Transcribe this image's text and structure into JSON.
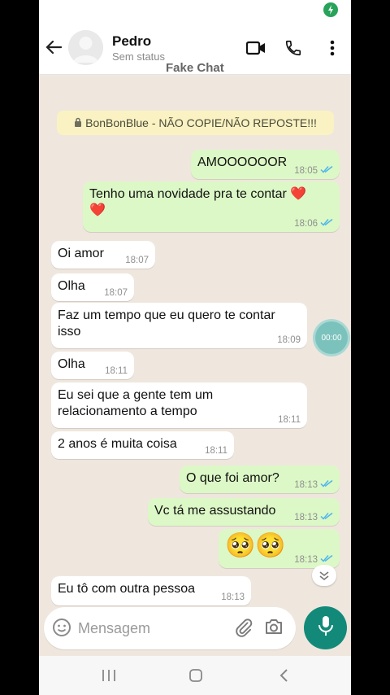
{
  "header": {
    "contact_name": "Pedro",
    "contact_status": "Sem status",
    "app_title": "Fake Chat"
  },
  "banner": {
    "text": "BonBonBlue - NÃO COPIE/NÃO REPOSTE!!!"
  },
  "messages": [
    {
      "dir": "out",
      "text": "AMOOOOOOR",
      "time": "18:05",
      "read": true
    },
    {
      "dir": "out",
      "text": "Tenho uma novidade pra te contar ❤️\n❤️",
      "time": "18:06",
      "read": true
    },
    {
      "dir": "in",
      "text": "Oi amor",
      "time": "18:07"
    },
    {
      "dir": "in",
      "text": "Olha",
      "time": "18:07"
    },
    {
      "dir": "in",
      "text": "Faz um tempo que eu quero te contar\nisso",
      "time": "18:09"
    },
    {
      "dir": "in",
      "text": "Olha",
      "time": "18:11"
    },
    {
      "dir": "in",
      "text": "Eu sei que a gente tem um\nrelacionamento a tempo",
      "time": "18:11"
    },
    {
      "dir": "in",
      "text": "2 anos é muita coisa",
      "time": "18:11"
    },
    {
      "dir": "out",
      "text": "O que foi amor?",
      "time": "18:13",
      "read": true
    },
    {
      "dir": "out",
      "text": "Vc tá me assustando",
      "time": "18:13",
      "read": true
    },
    {
      "dir": "out",
      "text": "🥺🥺",
      "time": "18:13",
      "read": true
    },
    {
      "dir": "in",
      "text": "Eu tô com outra pessoa",
      "time": "18:13"
    }
  ],
  "recording_timer": "00:00",
  "composer": {
    "placeholder": "Mensagem"
  },
  "colors": {
    "outgoing_bubble": "#dcf8c6",
    "incoming_bubble": "#ffffff",
    "accent": "#138a79",
    "read_tick": "#4fb6ec"
  },
  "icons": [
    "back-arrow-icon",
    "video-call-icon",
    "phone-icon",
    "more-vert-icon",
    "lock-icon",
    "read-ticks-icon",
    "emoji-icon",
    "attach-icon",
    "camera-icon",
    "mic-icon",
    "chevron-down-icon"
  ]
}
